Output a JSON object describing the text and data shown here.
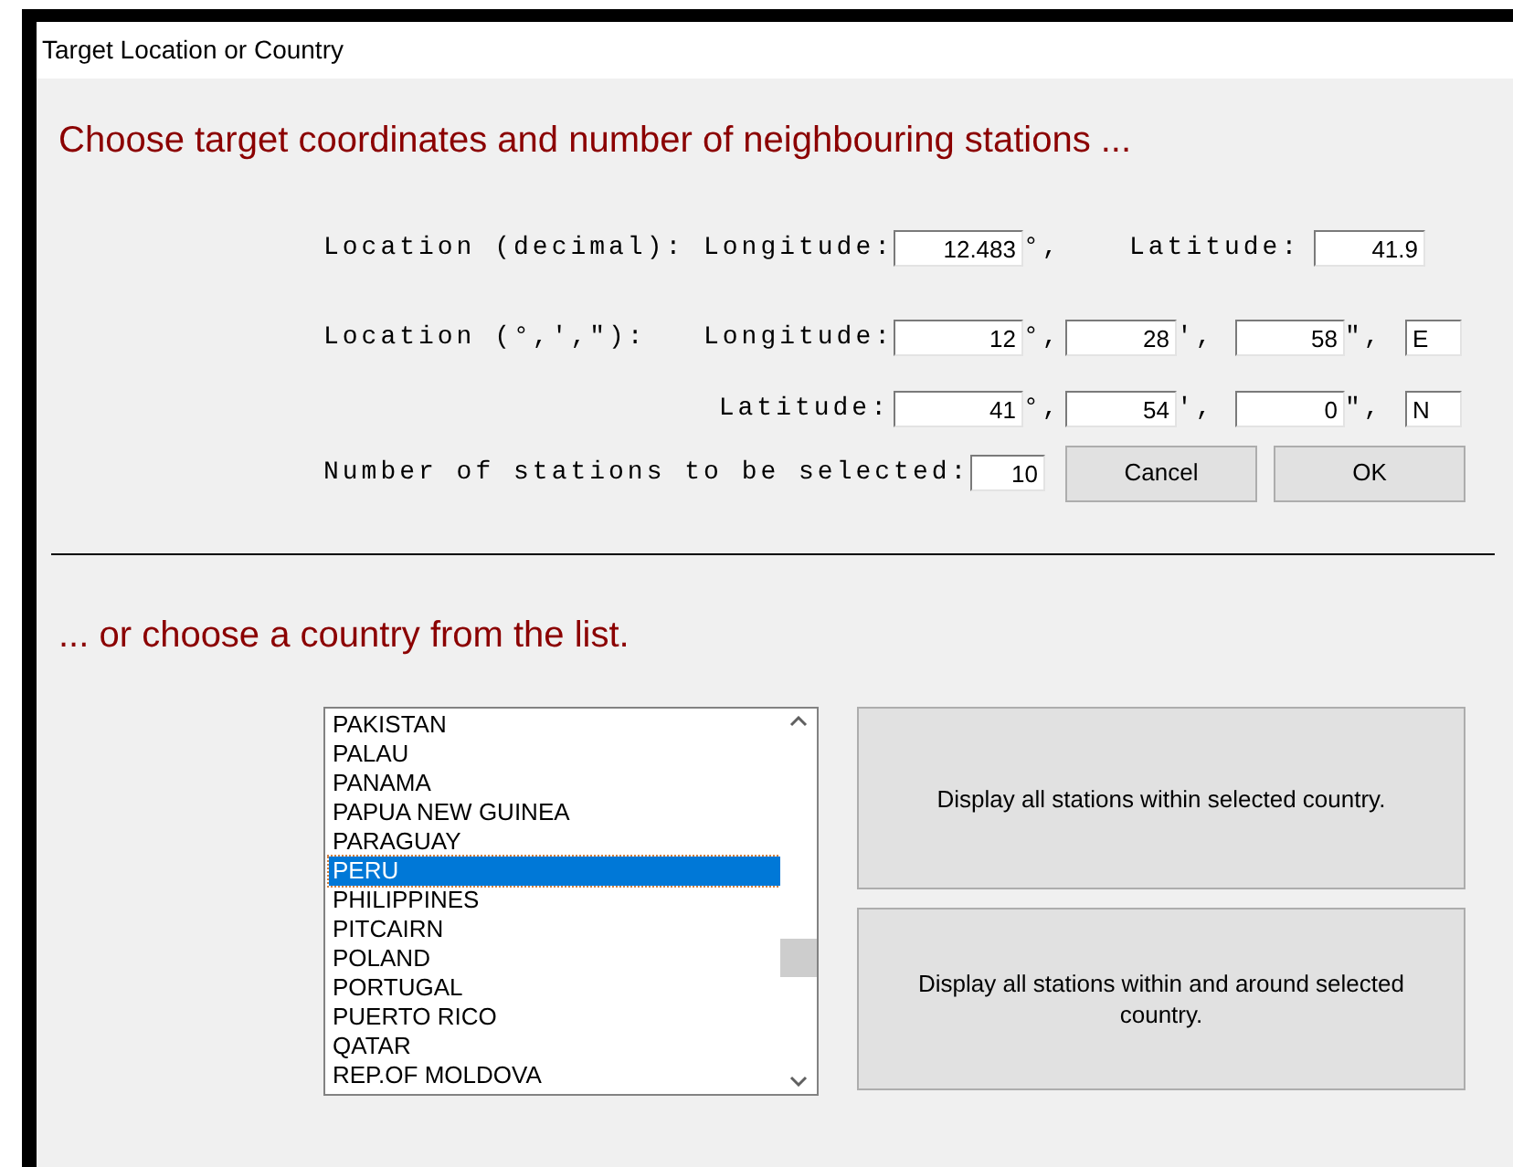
{
  "window": {
    "title": "Target Location or Country"
  },
  "heading": "Choose target coordinates and number of neighbouring stations ...",
  "decimal_row": {
    "label": "Location (decimal):",
    "longitude_label": "Longitude:",
    "longitude": "12.483",
    "longitude_unit": "°,",
    "latitude_label": "Latitude:",
    "latitude": "41.9"
  },
  "dms_longitude_row": {
    "label": "Location (°,',\"):",
    "field_label": "Longitude:",
    "degrees": "12",
    "degrees_unit": "°,",
    "minutes": "28",
    "minutes_unit": "',",
    "seconds": "58",
    "seconds_unit": "\",",
    "hemisphere": "E"
  },
  "dms_latitude_row": {
    "field_label": "Latitude:",
    "degrees": "41",
    "degrees_unit": "°,",
    "minutes": "54",
    "minutes_unit": "',",
    "seconds": "0",
    "seconds_unit": "\",",
    "hemisphere": "N"
  },
  "stations_row": {
    "label": "Number of stations to be selected:",
    "value": "10"
  },
  "buttons": [
    "Cancel",
    "OK"
  ],
  "country_heading": "... or choose a country from the list.",
  "countries": [
    {
      "name": "PAKISTAN",
      "selected": false
    },
    {
      "name": "PALAU",
      "selected": false
    },
    {
      "name": "PANAMA",
      "selected": false
    },
    {
      "name": "PAPUA NEW GUINEA",
      "selected": false
    },
    {
      "name": "PARAGUAY",
      "selected": false
    },
    {
      "name": "PERU",
      "selected": true
    },
    {
      "name": "PHILIPPINES",
      "selected": false
    },
    {
      "name": "PITCAIRN",
      "selected": false
    },
    {
      "name": "POLAND",
      "selected": false
    },
    {
      "name": "PORTUGAL",
      "selected": false
    },
    {
      "name": "PUERTO RICO",
      "selected": false
    },
    {
      "name": "QATAR",
      "selected": false
    },
    {
      "name": "REP.OF MOLDOVA",
      "selected": false
    }
  ],
  "country_buttons": [
    "Display all stations within selected country.",
    "Display all stations within and around selected country."
  ]
}
